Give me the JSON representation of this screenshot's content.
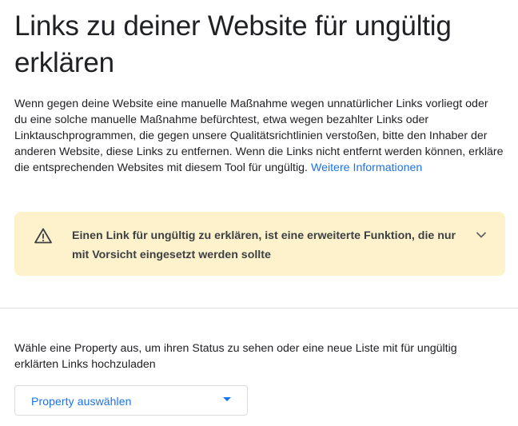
{
  "page": {
    "title": "Links zu deiner Website für ungültig erklären",
    "intro_text": "Wenn gegen deine Website eine manuelle Maßnahme wegen unnatürlicher Links vorliegt oder du eine solche manuelle Maßnahme befürchtest, etwa wegen bezahlter Links oder Linktauschprogrammen, die gegen unsere Qualitätsrichtlinien verstoßen, bitte den Inhaber der anderen Website, diese Links zu entfernen. Wenn die Links nicht entfernt werden können, erkläre die entsprechenden Websites mit diesem Tool für ungültig.",
    "intro_link": "Weitere Informationen"
  },
  "warning": {
    "icon": "warning-triangle-icon",
    "text": "Einen Link für ungültig zu erklären, ist eine erweiterte Funktion, die nur mit Vorsicht eingesetzt werden sollte",
    "expand_icon": "chevron-down-icon",
    "background_color": "#fef2cc"
  },
  "property": {
    "prompt": "Wähle eine Property aus, um ihren Status zu sehen oder eine neue Liste mit für ungültig erklärten Links hochzuladen",
    "select_label": "Property auswählen",
    "select_icon": "dropdown-arrow-icon"
  },
  "colors": {
    "accent": "#1a73e8",
    "text": "#202124",
    "divider": "#e0e0e0"
  }
}
